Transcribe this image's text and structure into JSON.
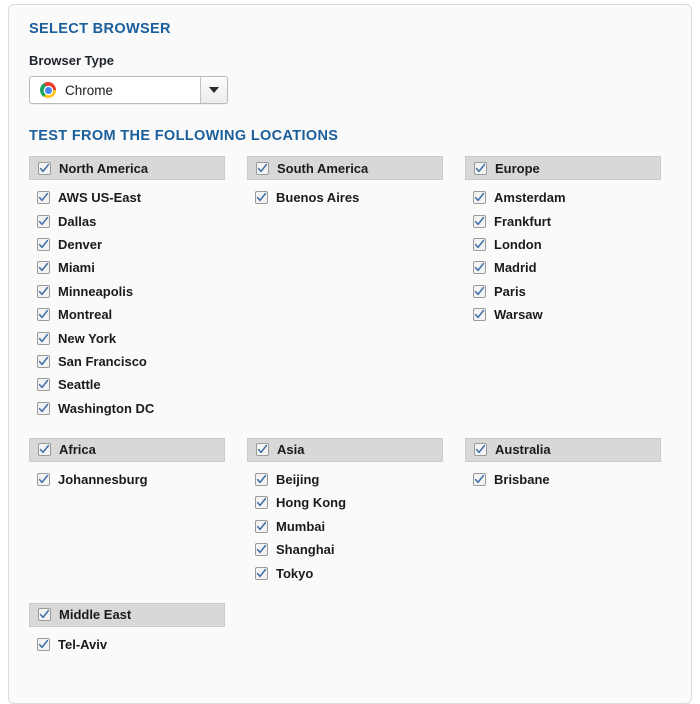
{
  "panel": {
    "browser_section_title": "SELECT BROWSER",
    "browser_type_label": "Browser Type",
    "locations_section_title": "TEST FROM THE FOLLOWING LOCATIONS"
  },
  "browser_select": {
    "selected": "Chrome",
    "icon": "chrome-icon",
    "arrow_icon": "chevron-down-icon",
    "options": [
      "Chrome"
    ]
  },
  "colors": {
    "heading_blue": "#1a5e9b",
    "group_header_bg": "#d8d8d8",
    "panel_bg": "#fafafa",
    "check_blue": "#3f6fa8"
  },
  "location_groups": [
    {
      "name": "North America",
      "checked": true,
      "cities": [
        {
          "name": "AWS US-East",
          "checked": true
        },
        {
          "name": "Dallas",
          "checked": true
        },
        {
          "name": "Denver",
          "checked": true
        },
        {
          "name": "Miami",
          "checked": true
        },
        {
          "name": "Minneapolis",
          "checked": true
        },
        {
          "name": "Montreal",
          "checked": true
        },
        {
          "name": "New York",
          "checked": true
        },
        {
          "name": "San Francisco",
          "checked": true
        },
        {
          "name": "Seattle",
          "checked": true
        },
        {
          "name": "Washington DC",
          "checked": true
        }
      ]
    },
    {
      "name": "South America",
      "checked": true,
      "cities": [
        {
          "name": "Buenos Aires",
          "checked": true
        }
      ]
    },
    {
      "name": "Europe",
      "checked": true,
      "cities": [
        {
          "name": "Amsterdam",
          "checked": true
        },
        {
          "name": "Frankfurt",
          "checked": true
        },
        {
          "name": "London",
          "checked": true
        },
        {
          "name": "Madrid",
          "checked": true
        },
        {
          "name": "Paris",
          "checked": true
        },
        {
          "name": "Warsaw",
          "checked": true
        }
      ]
    },
    {
      "name": "Africa",
      "checked": true,
      "cities": [
        {
          "name": "Johannesburg",
          "checked": true
        }
      ]
    },
    {
      "name": "Asia",
      "checked": true,
      "cities": [
        {
          "name": "Beijing",
          "checked": true
        },
        {
          "name": "Hong Kong",
          "checked": true
        },
        {
          "name": "Mumbai",
          "checked": true
        },
        {
          "name": "Shanghai",
          "checked": true
        },
        {
          "name": "Tokyo",
          "checked": true
        }
      ]
    },
    {
      "name": "Australia",
      "checked": true,
      "cities": [
        {
          "name": "Brisbane",
          "checked": true
        }
      ]
    },
    {
      "name": "Middle East",
      "checked": true,
      "cities": [
        {
          "name": "Tel-Aviv",
          "checked": true
        }
      ]
    }
  ]
}
